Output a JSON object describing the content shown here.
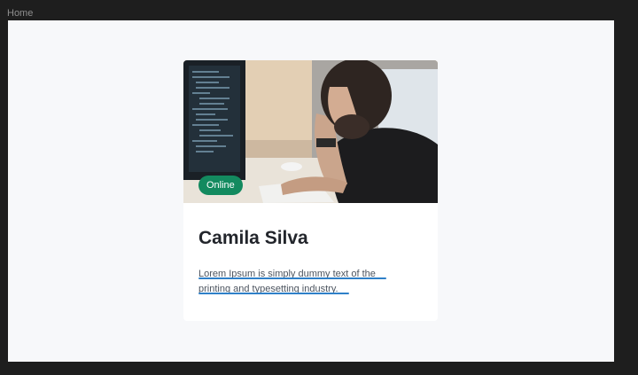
{
  "canvas": {
    "frame_label": "Home"
  },
  "card": {
    "image_icon": "photo-of-woman-at-computer",
    "status": "Online",
    "status_color": "#138a5f",
    "title": "Camila Silva",
    "description": "Lorem Ipsum is simply dummy text of the printing and typesetting industry.",
    "annotation_color": "#2f80c8"
  }
}
